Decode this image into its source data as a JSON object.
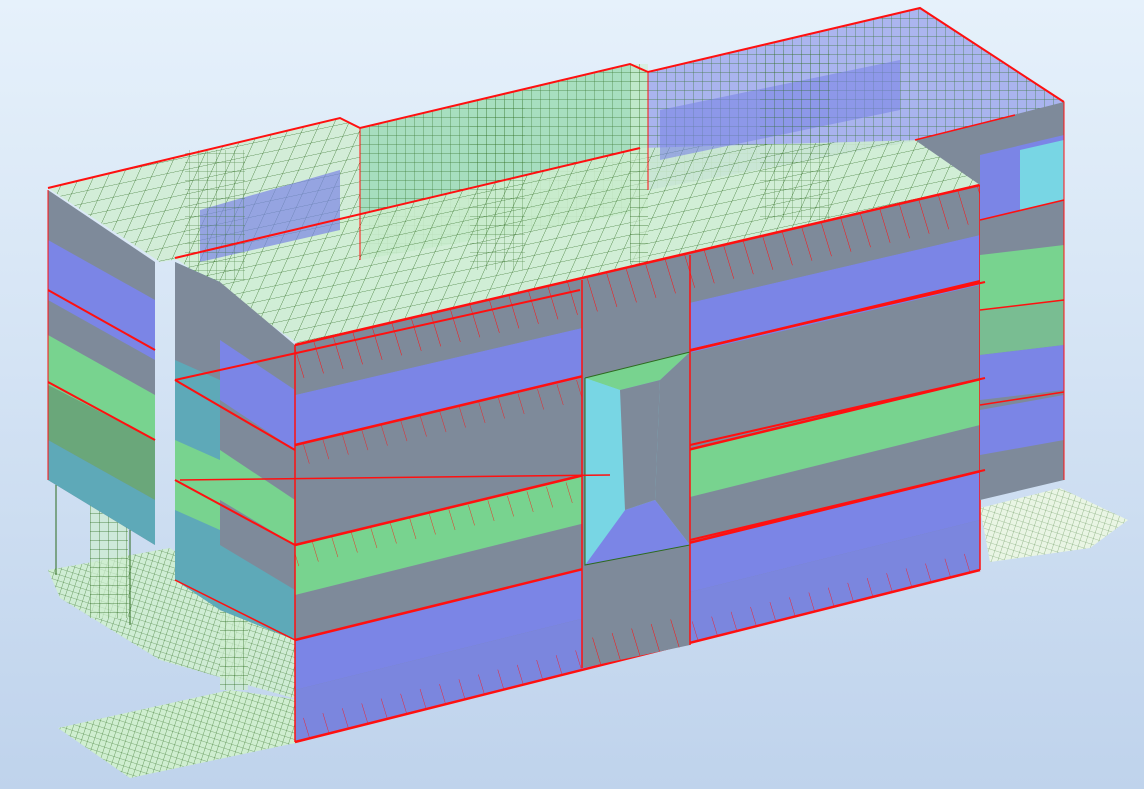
{
  "viewport": {
    "background_top": "#e6f1fb",
    "background_bottom": "#bfd3ec"
  },
  "model": {
    "view": "isometric-3d",
    "render_mode": "shaded-with-fe-mesh",
    "colors": {
      "mesh_green": "#cfeed0",
      "mesh_line": "#2c6a1e",
      "edge_red": "#ff1010",
      "band_blue": "#7b85e6",
      "band_gray": "#7e8a9a",
      "band_green": "#78d38f",
      "band_cyan": "#78d6e4",
      "band_teal": "#5ea9b8"
    }
  }
}
